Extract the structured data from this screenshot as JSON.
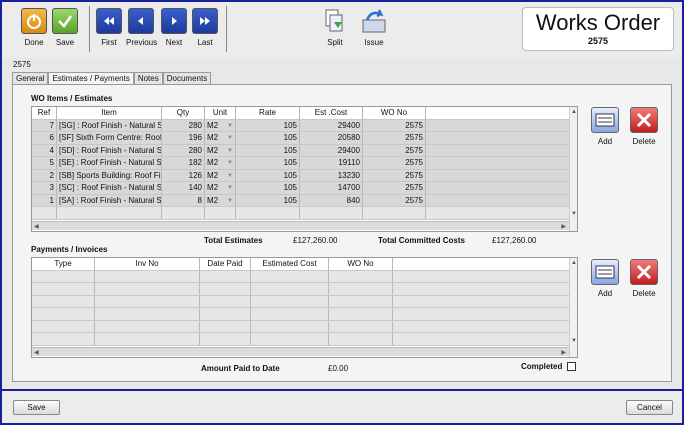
{
  "toolbar": {
    "done": "Done",
    "save": "Save",
    "first": "First",
    "previous": "Previous",
    "next": "Next",
    "last": "Last",
    "split": "Split",
    "issue": "Issue"
  },
  "header": {
    "title": "Works Order",
    "number": "2575"
  },
  "record_label": "2575",
  "tabs": [
    "General",
    "Estimates / Payments",
    "Notes",
    "Documents"
  ],
  "wo_items": {
    "title": "WO Items / Estimates",
    "columns": [
      "Ref",
      "Item",
      "Qty",
      "Unit",
      "Rate",
      "Est .Cost",
      "WO No"
    ],
    "rows": [
      {
        "ref": "7",
        "item": "[SG] : Roof Finish - Natural Sla",
        "qty": "280",
        "unit": "M2",
        "rate": "105",
        "cost": "29400",
        "wo": "2575"
      },
      {
        "ref": "6",
        "item": "[SF] Sixth Form Centre: Roof",
        "qty": "196",
        "unit": "M2",
        "rate": "105",
        "cost": "20580",
        "wo": "2575"
      },
      {
        "ref": "4",
        "item": "[SD] : Roof Finish - Natural Sla",
        "qty": "280",
        "unit": "M2",
        "rate": "105",
        "cost": "29400",
        "wo": "2575"
      },
      {
        "ref": "5",
        "item": "[SE] : Roof Finish - Natural Sla",
        "qty": "182",
        "unit": "M2",
        "rate": "105",
        "cost": "19110",
        "wo": "2575"
      },
      {
        "ref": "2",
        "item": "[SB] Sports Building: Roof Fini",
        "qty": "126",
        "unit": "M2",
        "rate": "105",
        "cost": "13230",
        "wo": "2575"
      },
      {
        "ref": "3",
        "item": "[SC] : Roof Finish - Natural Sla",
        "qty": "140",
        "unit": "M2",
        "rate": "105",
        "cost": "14700",
        "wo": "2575"
      },
      {
        "ref": "1",
        "item": "[SA] : Roof Finish - Natural Sla",
        "qty": "8",
        "unit": "M2",
        "rate": "105",
        "cost": "840",
        "wo": "2575"
      }
    ],
    "total_estimates_label": "Total Estimates",
    "total_estimates_value": "£127,260.00",
    "total_committed_label": "Total Committed Costs",
    "total_committed_value": "£127,260.00"
  },
  "payments": {
    "title": "Payments / Invoices",
    "columns": [
      "Type",
      "Inv No",
      "Date Paid",
      "Estimated Cost",
      "WO No"
    ],
    "amount_paid_label": "Amount Paid to Date",
    "amount_paid_value": "£0.00",
    "completed_label": "Completed"
  },
  "side_buttons": {
    "add": "Add",
    "delete": "Delete"
  },
  "footer": {
    "save": "Save",
    "cancel": "Cancel"
  }
}
